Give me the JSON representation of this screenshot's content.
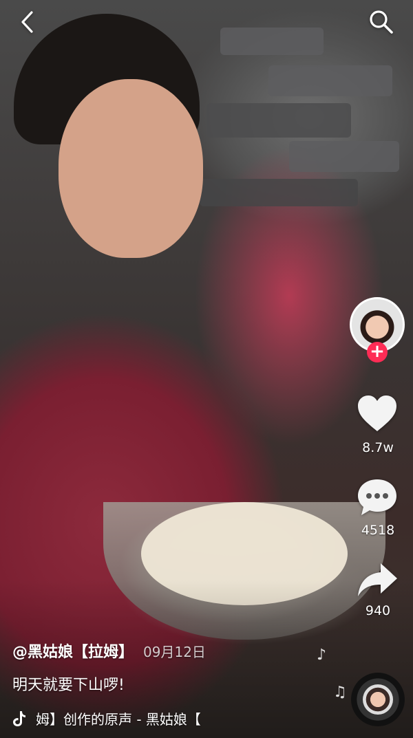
{
  "top_bar": {
    "back_icon": "chevron-left-icon",
    "search_icon": "search-icon"
  },
  "sidebar": {
    "like_count": "8.7w",
    "comment_count": "4518",
    "share_count": "940",
    "follow_symbol": "+"
  },
  "post": {
    "author": "@黑姑娘【拉姆】",
    "date": "09月12日",
    "caption": "明天就要下山啰!",
    "music_text": "姆】创作的原声 - 黑姑娘【"
  },
  "colors": {
    "accent": "#fe2c55",
    "text": "#ffffff"
  }
}
